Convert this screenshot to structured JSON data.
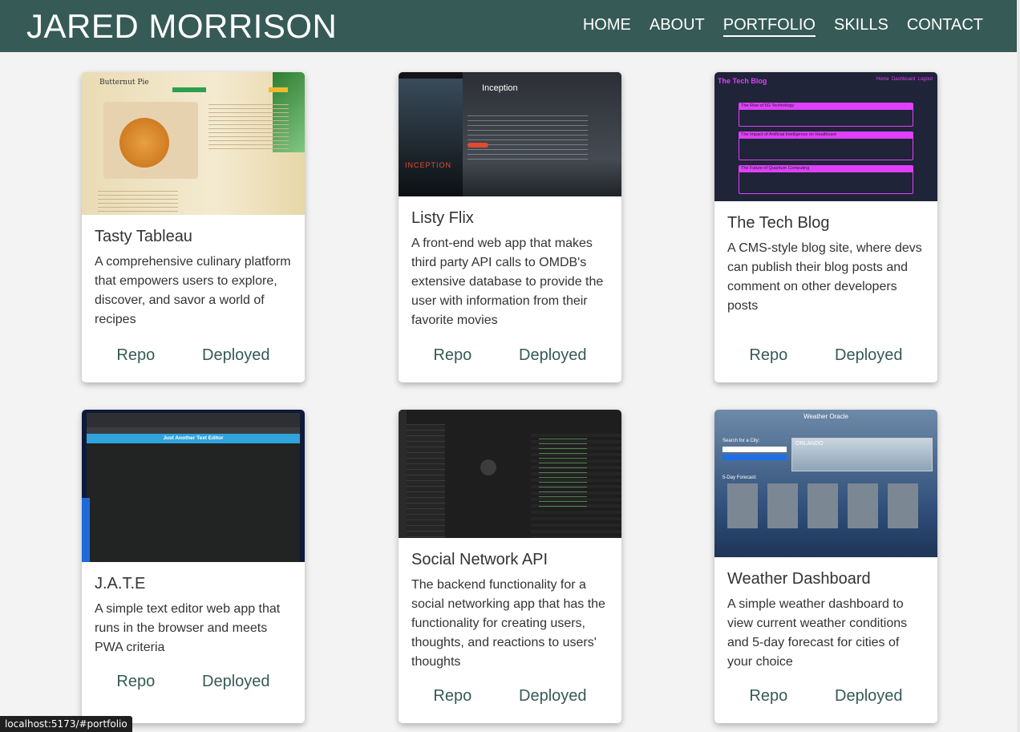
{
  "header": {
    "brand": "JARED MORRISON",
    "nav": [
      {
        "label": "HOME"
      },
      {
        "label": "ABOUT"
      },
      {
        "label": "PORTFOLIO"
      },
      {
        "label": "SKILLS"
      },
      {
        "label": "CONTACT"
      }
    ],
    "active": "PORTFOLIO"
  },
  "projects": [
    {
      "title": "Tasty Tableau",
      "description": "A comprehensive culinary platform that empowers users to explore, discover, and savor a world of recipes",
      "repo_label": "Repo",
      "deployed_label": "Deployed",
      "thumb": {
        "heading": "Butternut Pie"
      }
    },
    {
      "title": "Listy Flix",
      "description": "A front-end web app that makes third party API calls to OMDB's extensive database to provide the user with information from their favorite movies",
      "repo_label": "Repo",
      "deployed_label": "Deployed",
      "thumb": {
        "heading": "Inception",
        "poster": "INCEPTION"
      }
    },
    {
      "title": "The Tech Blog",
      "description": "A CMS-style blog site, where devs can publish their blog posts and comment on other developers posts",
      "repo_label": "Repo",
      "deployed_label": "Deployed",
      "thumb": {
        "heading": "The Tech Blog",
        "nav": "Home  Dashboard  Logout",
        "posts": [
          "The Rise of 5G Technology",
          "The Impact of Artificial Intelligence on Healthcare",
          "The Future of Quantum Computing"
        ]
      }
    },
    {
      "title": "J.A.T.E",
      "description": "A simple text editor web app that runs in the browser and meets PWA criteria",
      "repo_label": "Repo",
      "deployed_label": "Deployed",
      "thumb": {
        "heading": "Just Another Text Editor"
      }
    },
    {
      "title": "Social Network API",
      "description": "The backend functionality for a social networking app that has the functionality for creating users, thoughts, and reactions to users' thoughts",
      "repo_label": "Repo",
      "deployed_label": "Deployed",
      "thumb": {}
    },
    {
      "title": "Weather Dashboard",
      "description": "A simple weather dashboard to view current weather conditions and 5-day forecast for cities of your choice",
      "repo_label": "Repo",
      "deployed_label": "Deployed",
      "thumb": {
        "heading": "Weather Oracle",
        "search_label": "Search for a City:",
        "city": "ORLANDO",
        "forecast_label": "5-Day Forecast:"
      }
    }
  ],
  "status_bar": "localhost:5173/#portfolio",
  "colors": {
    "header_bg": "#365a56",
    "link": "#365a56",
    "page_bg": "#f3f3f3"
  }
}
